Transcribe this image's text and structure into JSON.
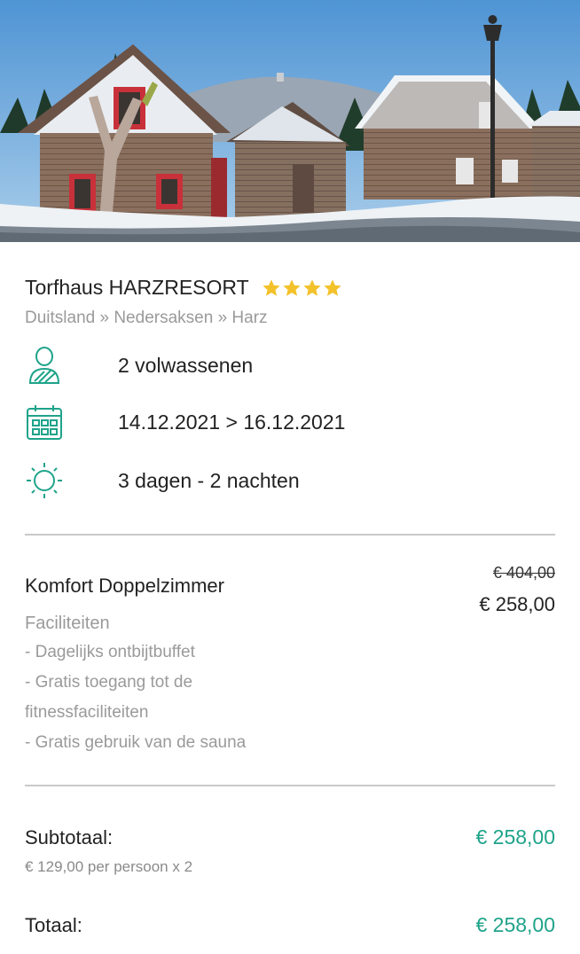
{
  "hotel": {
    "name": "Torfhaus HARZRESORT",
    "stars": 4,
    "breadcrumb": "Duitsland » Nedersaksen » Harz"
  },
  "details": {
    "guests": "2 volwassenen",
    "dates": "14.12.2021 > 16.12.2021",
    "duration": "3 dagen - 2 nachten"
  },
  "room": {
    "name": "Komfort Doppelzimmer",
    "old_price": "€ 404,00",
    "price": "€ 258,00",
    "facilities_title": "Faciliteiten",
    "facilities": [
      "- Dagelijks ontbijtbuffet",
      "- Gratis toegang tot de",
      "fitnessfaciliteiten",
      "- Gratis gebruik van de sauna"
    ]
  },
  "summary": {
    "subtotal_label": "Subtotaal:",
    "subtotal_value": "€ 258,00",
    "subtotal_note": "€ 129,00 per persoon x 2",
    "total_label": "Totaal:",
    "total_value": "€ 258,00"
  },
  "colors": {
    "accent": "#1fa38a",
    "star": "#f3c12a",
    "muted": "#9a9a9a"
  },
  "icons": {
    "guests": "person-icon",
    "dates": "calendar-icon",
    "duration": "sun-icon"
  }
}
